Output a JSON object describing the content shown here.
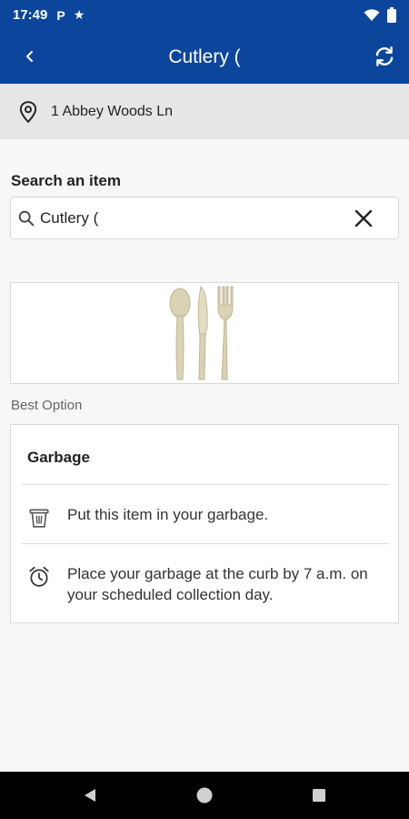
{
  "status_bar": {
    "time": "17:49",
    "icons": [
      "parking-icon",
      "star-icon",
      "wifi-icon",
      "battery-icon"
    ],
    "parking_glyph": "P",
    "star_glyph": "★"
  },
  "app_bar": {
    "title": "Cutlery (",
    "background": "#0c469c"
  },
  "address": {
    "text": "1 Abbey Woods Ln"
  },
  "search": {
    "label": "Search an item",
    "value": "Cutlery ("
  },
  "result": {
    "section_label": "Best Option",
    "card_title": "Garbage",
    "rows": [
      {
        "icon": "garbage-bin-icon",
        "text": "Put this item in your garbage."
      },
      {
        "icon": "alarm-clock-icon",
        "text": "Place your garbage at the curb by 7 a.m. on your scheduled collection day."
      }
    ]
  }
}
